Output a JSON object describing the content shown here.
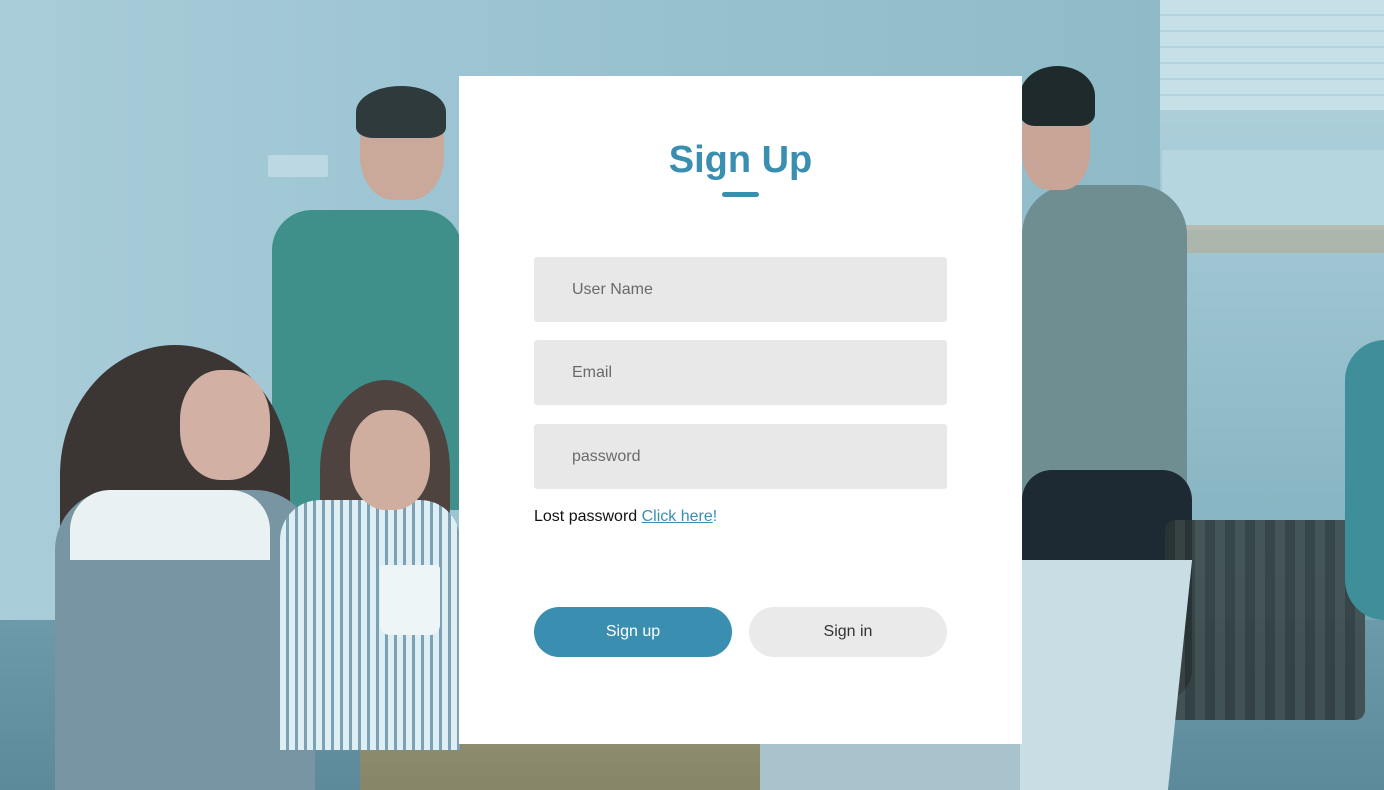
{
  "form": {
    "title": "Sign Up",
    "username_placeholder": "User Name",
    "email_placeholder": "Email",
    "password_placeholder": "password",
    "lost_password_text": "Lost password ",
    "lost_password_link": "Click here",
    "lost_password_suffix": "!",
    "signup_label": "Sign up",
    "signin_label": "Sign in"
  },
  "colors": {
    "accent": "#3a8fb0",
    "field_background": "#e8e8e8",
    "card_background": "#ffffff"
  }
}
